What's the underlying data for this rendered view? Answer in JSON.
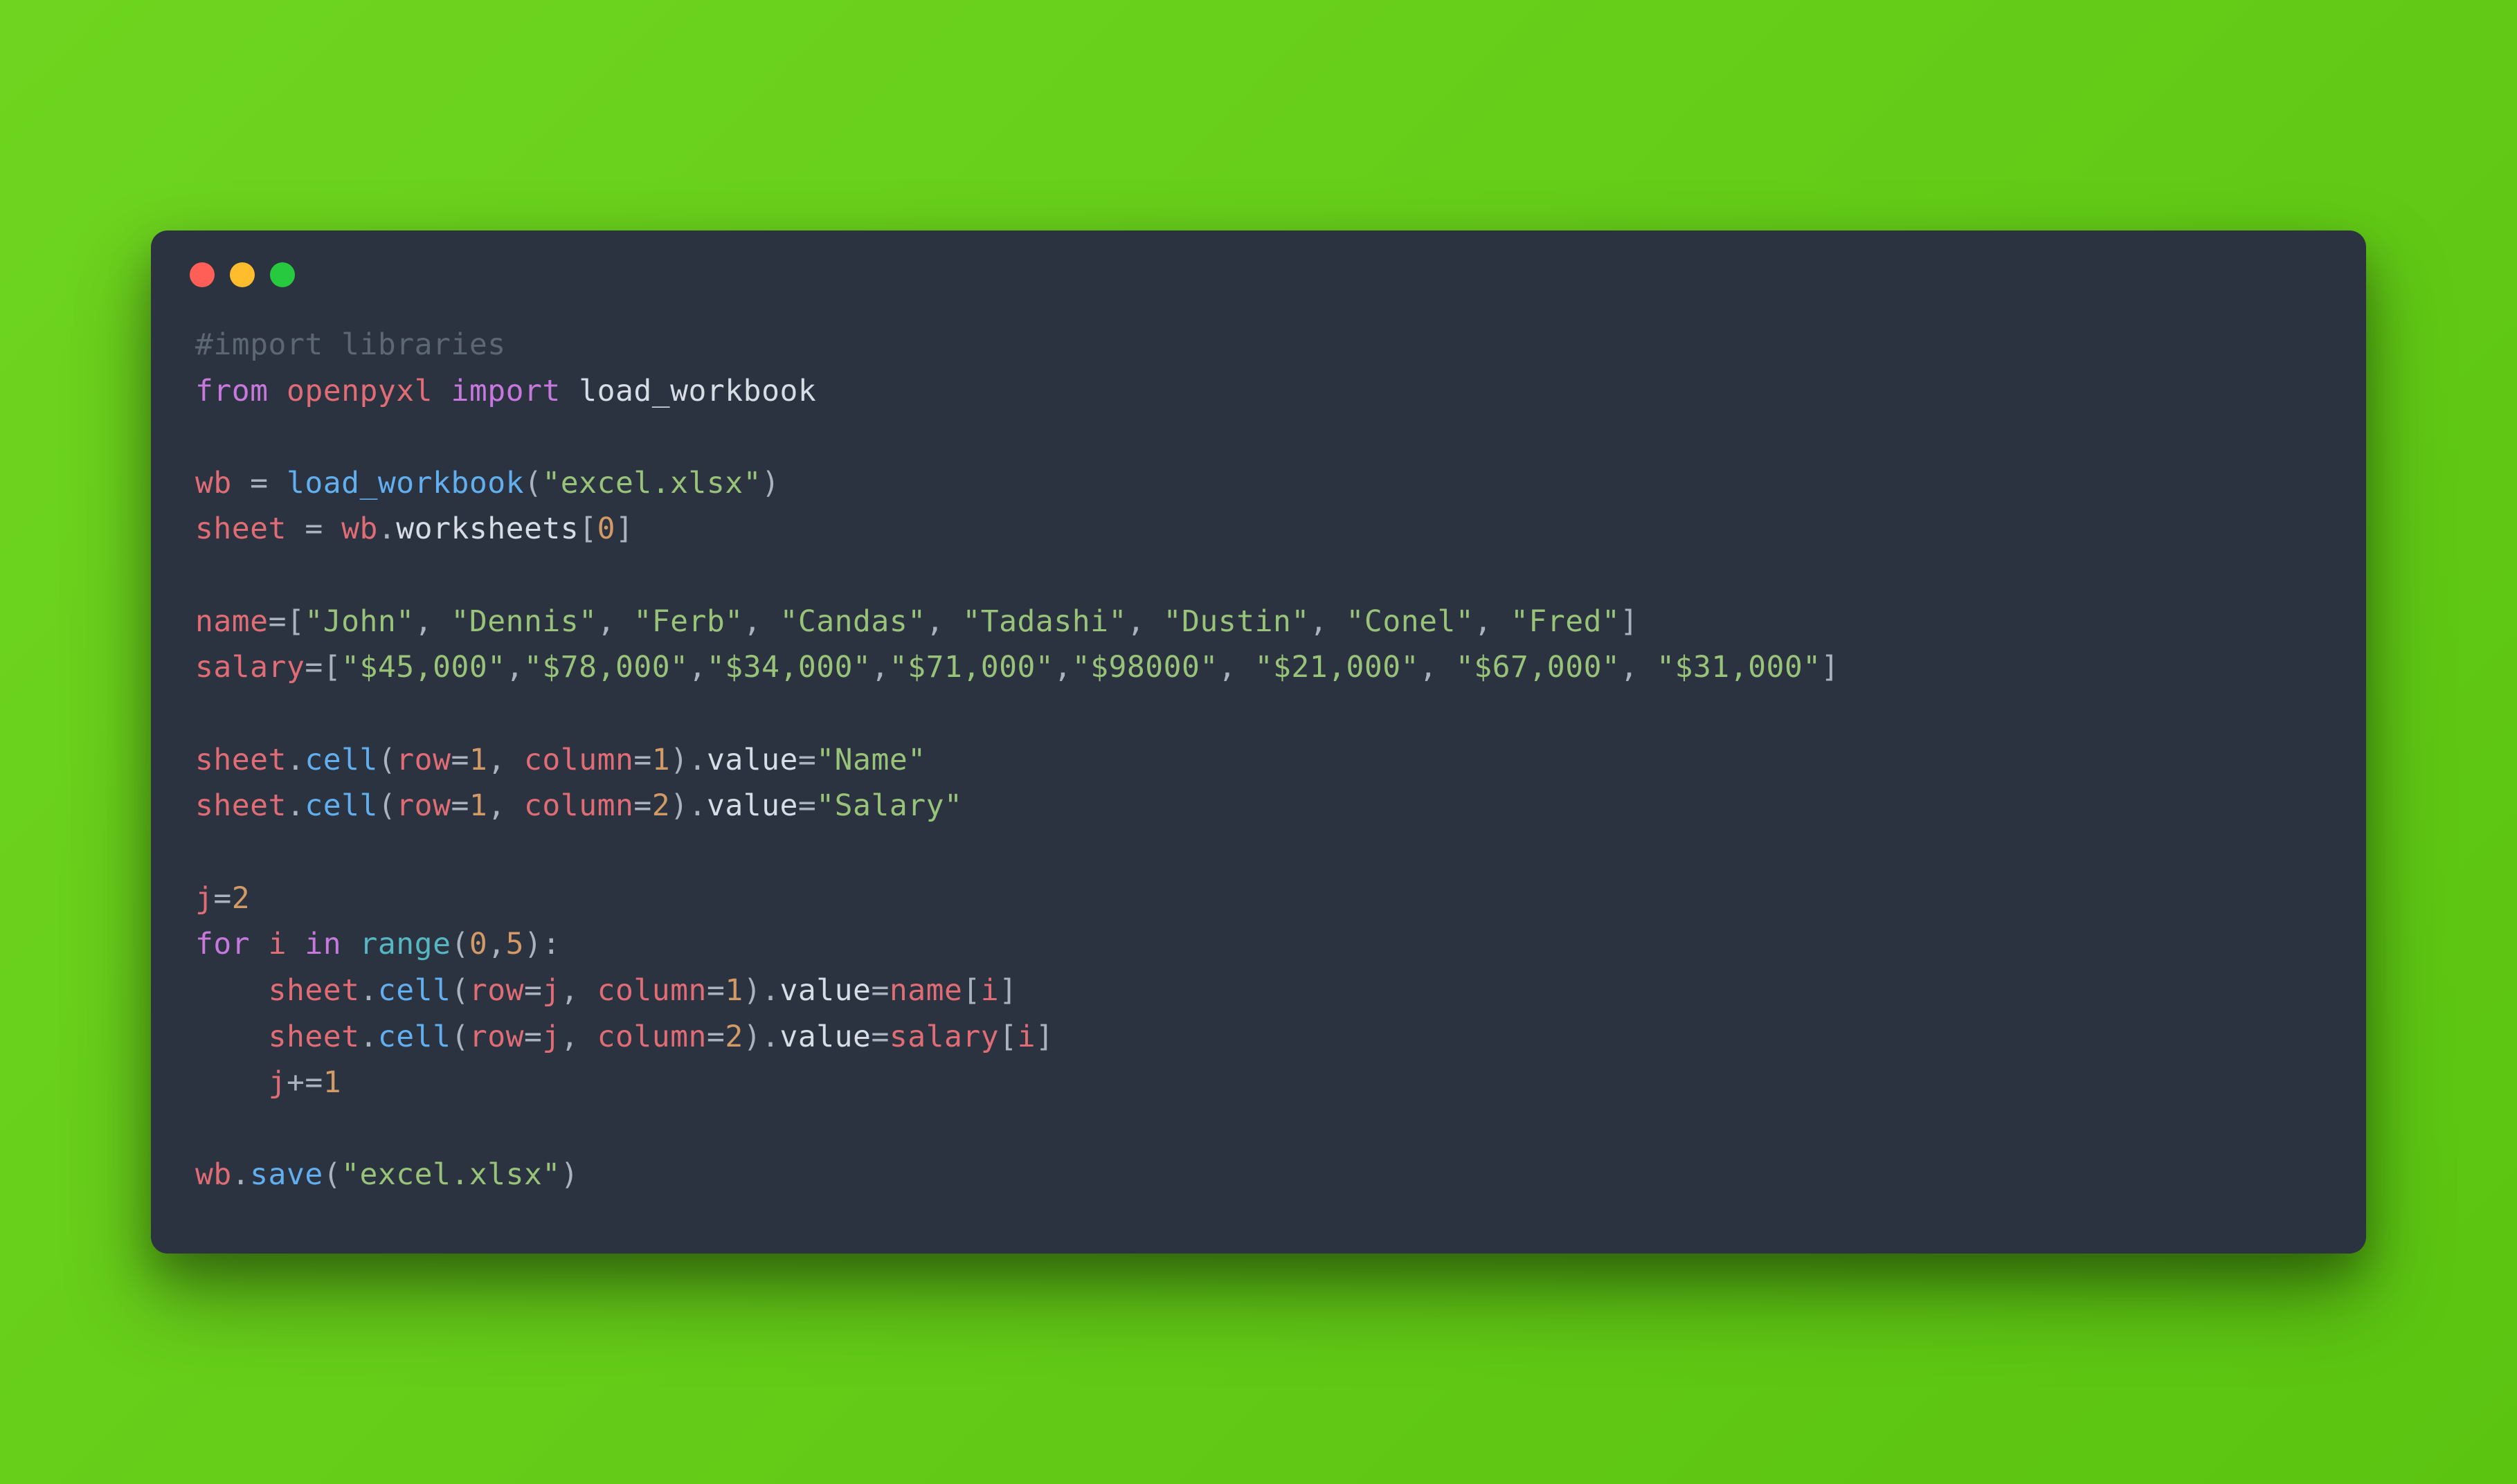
{
  "traffic_lights": {
    "red": "#ff5f56",
    "yellow": "#ffbd2e",
    "green": "#27c93f"
  },
  "code": {
    "tokens": [
      [
        [
          "comment",
          "#import libraries"
        ]
      ],
      [
        [
          "keyword",
          "from"
        ],
        [
          "default",
          " "
        ],
        [
          "ident",
          "openpyxl"
        ],
        [
          "default",
          " "
        ],
        [
          "keyword",
          "import"
        ],
        [
          "default",
          " "
        ],
        [
          "default",
          "load_workbook"
        ]
      ],
      [],
      [
        [
          "ident",
          "wb"
        ],
        [
          "default",
          " "
        ],
        [
          "op",
          "="
        ],
        [
          "default",
          " "
        ],
        [
          "func",
          "load_workbook"
        ],
        [
          "op",
          "("
        ],
        [
          "string",
          "\"excel.xlsx\""
        ],
        [
          "op",
          ")"
        ]
      ],
      [
        [
          "ident",
          "sheet"
        ],
        [
          "default",
          " "
        ],
        [
          "op",
          "="
        ],
        [
          "default",
          " "
        ],
        [
          "ident",
          "wb"
        ],
        [
          "op",
          "."
        ],
        [
          "default",
          "worksheets"
        ],
        [
          "op",
          "["
        ],
        [
          "number",
          "0"
        ],
        [
          "op",
          "]"
        ]
      ],
      [],
      [
        [
          "ident",
          "name"
        ],
        [
          "op",
          "=["
        ],
        [
          "string",
          "\"John\""
        ],
        [
          "op",
          ", "
        ],
        [
          "string",
          "\"Dennis\""
        ],
        [
          "op",
          ", "
        ],
        [
          "string",
          "\"Ferb\""
        ],
        [
          "op",
          ", "
        ],
        [
          "string",
          "\"Candas\""
        ],
        [
          "op",
          ", "
        ],
        [
          "string",
          "\"Tadashi\""
        ],
        [
          "op",
          ", "
        ],
        [
          "string",
          "\"Dustin\""
        ],
        [
          "op",
          ", "
        ],
        [
          "string",
          "\"Conel\""
        ],
        [
          "op",
          ", "
        ],
        [
          "string",
          "\"Fred\""
        ],
        [
          "op",
          "]"
        ]
      ],
      [
        [
          "ident",
          "salary"
        ],
        [
          "op",
          "=["
        ],
        [
          "string",
          "\"$45,000\""
        ],
        [
          "op",
          ","
        ],
        [
          "string",
          "\"$78,000\""
        ],
        [
          "op",
          ","
        ],
        [
          "string",
          "\"$34,000\""
        ],
        [
          "op",
          ","
        ],
        [
          "string",
          "\"$71,000\""
        ],
        [
          "op",
          ","
        ],
        [
          "string",
          "\"$98000\""
        ],
        [
          "op",
          ", "
        ],
        [
          "string",
          "\"$21,000\""
        ],
        [
          "op",
          ", "
        ],
        [
          "string",
          "\"$67,000\""
        ],
        [
          "op",
          ", "
        ],
        [
          "string",
          "\"$31,000\""
        ],
        [
          "op",
          "]"
        ]
      ],
      [],
      [
        [
          "ident",
          "sheet"
        ],
        [
          "op",
          "."
        ],
        [
          "func",
          "cell"
        ],
        [
          "op",
          "("
        ],
        [
          "ident",
          "row"
        ],
        [
          "op",
          "="
        ],
        [
          "number",
          "1"
        ],
        [
          "op",
          ", "
        ],
        [
          "ident",
          "column"
        ],
        [
          "op",
          "="
        ],
        [
          "number",
          "1"
        ],
        [
          "op",
          ")."
        ],
        [
          "default",
          "value"
        ],
        [
          "op",
          "="
        ],
        [
          "string",
          "\"Name\""
        ]
      ],
      [
        [
          "ident",
          "sheet"
        ],
        [
          "op",
          "."
        ],
        [
          "func",
          "cell"
        ],
        [
          "op",
          "("
        ],
        [
          "ident",
          "row"
        ],
        [
          "op",
          "="
        ],
        [
          "number",
          "1"
        ],
        [
          "op",
          ", "
        ],
        [
          "ident",
          "column"
        ],
        [
          "op",
          "="
        ],
        [
          "number",
          "2"
        ],
        [
          "op",
          ")."
        ],
        [
          "default",
          "value"
        ],
        [
          "op",
          "="
        ],
        [
          "string",
          "\"Salary\""
        ]
      ],
      [],
      [
        [
          "ident",
          "j"
        ],
        [
          "op",
          "="
        ],
        [
          "number",
          "2"
        ]
      ],
      [
        [
          "keyword",
          "for"
        ],
        [
          "default",
          " "
        ],
        [
          "ident",
          "i"
        ],
        [
          "default",
          " "
        ],
        [
          "keyword",
          "in"
        ],
        [
          "default",
          " "
        ],
        [
          "builtin",
          "range"
        ],
        [
          "op",
          "("
        ],
        [
          "number",
          "0"
        ],
        [
          "op",
          ","
        ],
        [
          "number",
          "5"
        ],
        [
          "op",
          ")"
        ],
        [
          "op",
          ":"
        ]
      ],
      [
        [
          "default",
          "    "
        ],
        [
          "ident",
          "sheet"
        ],
        [
          "op",
          "."
        ],
        [
          "func",
          "cell"
        ],
        [
          "op",
          "("
        ],
        [
          "ident",
          "row"
        ],
        [
          "op",
          "="
        ],
        [
          "ident",
          "j"
        ],
        [
          "op",
          ", "
        ],
        [
          "ident",
          "column"
        ],
        [
          "op",
          "="
        ],
        [
          "number",
          "1"
        ],
        [
          "op",
          ")."
        ],
        [
          "default",
          "value"
        ],
        [
          "op",
          "="
        ],
        [
          "ident",
          "name"
        ],
        [
          "op",
          "["
        ],
        [
          "ident",
          "i"
        ],
        [
          "op",
          "]"
        ]
      ],
      [
        [
          "default",
          "    "
        ],
        [
          "ident",
          "sheet"
        ],
        [
          "op",
          "."
        ],
        [
          "func",
          "cell"
        ],
        [
          "op",
          "("
        ],
        [
          "ident",
          "row"
        ],
        [
          "op",
          "="
        ],
        [
          "ident",
          "j"
        ],
        [
          "op",
          ", "
        ],
        [
          "ident",
          "column"
        ],
        [
          "op",
          "="
        ],
        [
          "number",
          "2"
        ],
        [
          "op",
          ")."
        ],
        [
          "default",
          "value"
        ],
        [
          "op",
          "="
        ],
        [
          "ident",
          "salary"
        ],
        [
          "op",
          "["
        ],
        [
          "ident",
          "i"
        ],
        [
          "op",
          "]"
        ]
      ],
      [
        [
          "default",
          "    "
        ],
        [
          "ident",
          "j"
        ],
        [
          "op",
          "+="
        ],
        [
          "number",
          "1"
        ]
      ],
      [],
      [
        [
          "ident",
          "wb"
        ],
        [
          "op",
          "."
        ],
        [
          "func",
          "save"
        ],
        [
          "op",
          "("
        ],
        [
          "string",
          "\"excel.xlsx\""
        ],
        [
          "op",
          ")"
        ]
      ]
    ]
  }
}
